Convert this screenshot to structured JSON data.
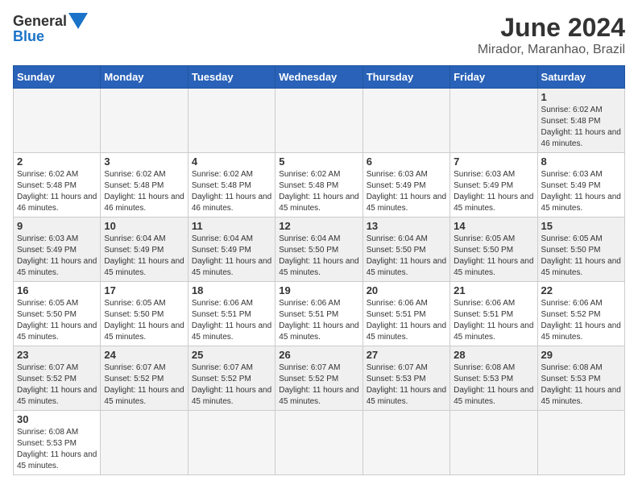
{
  "header": {
    "logo_general": "General",
    "logo_blue": "Blue",
    "month_title": "June 2024",
    "subtitle": "Mirador, Maranhao, Brazil"
  },
  "days_of_week": [
    "Sunday",
    "Monday",
    "Tuesday",
    "Wednesday",
    "Thursday",
    "Friday",
    "Saturday"
  ],
  "weeks": [
    [
      null,
      null,
      null,
      null,
      null,
      null,
      {
        "day": "1",
        "sunrise": "6:02 AM",
        "sunset": "5:48 PM",
        "daylight": "11 hours and 46 minutes."
      }
    ],
    [
      {
        "day": "2",
        "sunrise": "6:02 AM",
        "sunset": "5:48 PM",
        "daylight": "11 hours and 46 minutes."
      },
      {
        "day": "3",
        "sunrise": "6:02 AM",
        "sunset": "5:48 PM",
        "daylight": "11 hours and 46 minutes."
      },
      {
        "day": "4",
        "sunrise": "6:02 AM",
        "sunset": "5:48 PM",
        "daylight": "11 hours and 46 minutes."
      },
      {
        "day": "5",
        "sunrise": "6:02 AM",
        "sunset": "5:48 PM",
        "daylight": "11 hours and 45 minutes."
      },
      {
        "day": "6",
        "sunrise": "6:03 AM",
        "sunset": "5:49 PM",
        "daylight": "11 hours and 45 minutes."
      },
      {
        "day": "7",
        "sunrise": "6:03 AM",
        "sunset": "5:49 PM",
        "daylight": "11 hours and 45 minutes."
      },
      {
        "day": "8",
        "sunrise": "6:03 AM",
        "sunset": "5:49 PM",
        "daylight": "11 hours and 45 minutes."
      }
    ],
    [
      {
        "day": "9",
        "sunrise": "6:03 AM",
        "sunset": "5:49 PM",
        "daylight": "11 hours and 45 minutes."
      },
      {
        "day": "10",
        "sunrise": "6:04 AM",
        "sunset": "5:49 PM",
        "daylight": "11 hours and 45 minutes."
      },
      {
        "day": "11",
        "sunrise": "6:04 AM",
        "sunset": "5:49 PM",
        "daylight": "11 hours and 45 minutes."
      },
      {
        "day": "12",
        "sunrise": "6:04 AM",
        "sunset": "5:50 PM",
        "daylight": "11 hours and 45 minutes."
      },
      {
        "day": "13",
        "sunrise": "6:04 AM",
        "sunset": "5:50 PM",
        "daylight": "11 hours and 45 minutes."
      },
      {
        "day": "14",
        "sunrise": "6:05 AM",
        "sunset": "5:50 PM",
        "daylight": "11 hours and 45 minutes."
      },
      {
        "day": "15",
        "sunrise": "6:05 AM",
        "sunset": "5:50 PM",
        "daylight": "11 hours and 45 minutes."
      }
    ],
    [
      {
        "day": "16",
        "sunrise": "6:05 AM",
        "sunset": "5:50 PM",
        "daylight": "11 hours and 45 minutes."
      },
      {
        "day": "17",
        "sunrise": "6:05 AM",
        "sunset": "5:50 PM",
        "daylight": "11 hours and 45 minutes."
      },
      {
        "day": "18",
        "sunrise": "6:06 AM",
        "sunset": "5:51 PM",
        "daylight": "11 hours and 45 minutes."
      },
      {
        "day": "19",
        "sunrise": "6:06 AM",
        "sunset": "5:51 PM",
        "daylight": "11 hours and 45 minutes."
      },
      {
        "day": "20",
        "sunrise": "6:06 AM",
        "sunset": "5:51 PM",
        "daylight": "11 hours and 45 minutes."
      },
      {
        "day": "21",
        "sunrise": "6:06 AM",
        "sunset": "5:51 PM",
        "daylight": "11 hours and 45 minutes."
      },
      {
        "day": "22",
        "sunrise": "6:06 AM",
        "sunset": "5:52 PM",
        "daylight": "11 hours and 45 minutes."
      }
    ],
    [
      {
        "day": "23",
        "sunrise": "6:07 AM",
        "sunset": "5:52 PM",
        "daylight": "11 hours and 45 minutes."
      },
      {
        "day": "24",
        "sunrise": "6:07 AM",
        "sunset": "5:52 PM",
        "daylight": "11 hours and 45 minutes."
      },
      {
        "day": "25",
        "sunrise": "6:07 AM",
        "sunset": "5:52 PM",
        "daylight": "11 hours and 45 minutes."
      },
      {
        "day": "26",
        "sunrise": "6:07 AM",
        "sunset": "5:52 PM",
        "daylight": "11 hours and 45 minutes."
      },
      {
        "day": "27",
        "sunrise": "6:07 AM",
        "sunset": "5:53 PM",
        "daylight": "11 hours and 45 minutes."
      },
      {
        "day": "28",
        "sunrise": "6:08 AM",
        "sunset": "5:53 PM",
        "daylight": "11 hours and 45 minutes."
      },
      {
        "day": "29",
        "sunrise": "6:08 AM",
        "sunset": "5:53 PM",
        "daylight": "11 hours and 45 minutes."
      }
    ],
    [
      {
        "day": "30",
        "sunrise": "6:08 AM",
        "sunset": "5:53 PM",
        "daylight": "11 hours and 45 minutes."
      },
      null,
      null,
      null,
      null,
      null,
      null
    ]
  ]
}
